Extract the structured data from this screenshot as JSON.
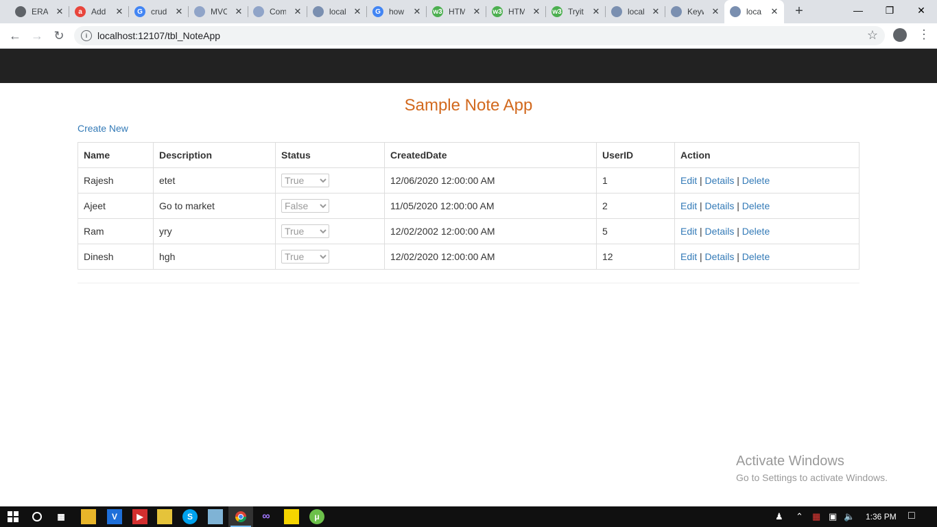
{
  "browser": {
    "tabs": [
      {
        "title": "ERAI",
        "favicon_color": "#5f6368",
        "favicon_glyph": "globe-icon"
      },
      {
        "title": "Add",
        "favicon_color": "#e8453c",
        "favicon_glyph": "a"
      },
      {
        "title": "crud",
        "favicon_color": "#4285f4",
        "favicon_glyph": "G"
      },
      {
        "title": "MVC",
        "favicon_color": "#90a4c8",
        "favicon_glyph": "bird-icon"
      },
      {
        "title": "Com",
        "favicon_color": "#90a4c8",
        "favicon_glyph": "bird-icon"
      },
      {
        "title": "local",
        "favicon_color": "#7a8fb0",
        "favicon_glyph": "page-icon"
      },
      {
        "title": "how",
        "favicon_color": "#4285f4",
        "favicon_glyph": "G"
      },
      {
        "title": "HTM",
        "favicon_color": "#4caf50",
        "favicon_glyph": "w3"
      },
      {
        "title": "HTM",
        "favicon_color": "#4caf50",
        "favicon_glyph": "w3"
      },
      {
        "title": "Tryit",
        "favicon_color": "#4caf50",
        "favicon_glyph": "w3"
      },
      {
        "title": "local",
        "favicon_color": "#7a8fb0",
        "favicon_glyph": "page-icon"
      },
      {
        "title": "Keyw",
        "favicon_color": "#7a8fb0",
        "favicon_glyph": "page-icon"
      },
      {
        "title": "loca",
        "favicon_color": "#7a8fb0",
        "favicon_glyph": "page-icon"
      }
    ],
    "active_tab_index": 12,
    "url": "localhost:12107/tbl_NoteApp"
  },
  "page": {
    "title": "Sample Note App",
    "create_new": "Create New",
    "table": {
      "headers": [
        "Name",
        "Description",
        "Status",
        "CreatedDate",
        "UserID",
        "Action"
      ],
      "rows": [
        {
          "name": "Rajesh",
          "description": "etet",
          "status": "True",
          "created": "12/06/2020 12:00:00 AM",
          "userid": "1"
        },
        {
          "name": "Ajeet",
          "description": "Go to market",
          "status": "False",
          "created": "11/05/2020 12:00:00 AM",
          "userid": "2"
        },
        {
          "name": "Ram",
          "description": "yry",
          "status": "True",
          "created": "12/02/2002 12:00:00 AM",
          "userid": "5"
        },
        {
          "name": "Dinesh",
          "description": "hgh",
          "status": "True",
          "created": "12/02/2020 12:00:00 AM",
          "userid": "12"
        }
      ],
      "status_options": [
        "True",
        "False"
      ],
      "actions": {
        "edit": "Edit",
        "details": "Details",
        "delete": "Delete",
        "separator": "|"
      }
    }
  },
  "watermark": {
    "line1": "Activate Windows",
    "line2": "Go to Settings to activate Windows."
  },
  "taskbar": {
    "clock": "1:36 PM"
  }
}
